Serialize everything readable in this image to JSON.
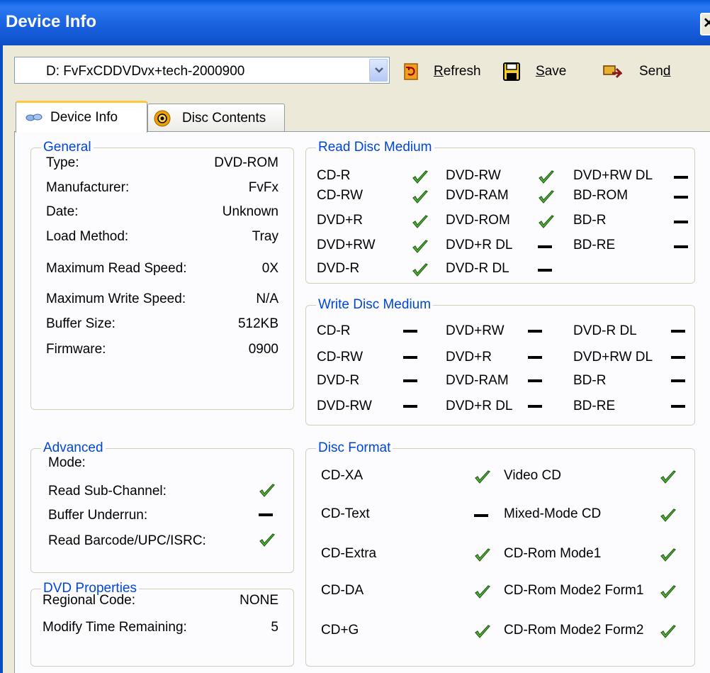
{
  "window": {
    "title": "Device Info"
  },
  "toolbar": {
    "drive_select": "D: FvFxCDDVDvx+tech-2000900",
    "refresh": {
      "pre": "",
      "key": "R",
      "post": "efresh"
    },
    "save": {
      "pre": "",
      "key": "S",
      "post": "ave"
    },
    "send": {
      "pre": "Sen",
      "key": "d",
      "post": ""
    }
  },
  "tabs": {
    "device_info": "Device Info",
    "disc_contents": "Disc Contents"
  },
  "general": {
    "title": "General",
    "rows": [
      {
        "label": "Type:",
        "value": "DVD-ROM"
      },
      {
        "label": "Manufacturer:",
        "value": "FvFx"
      },
      {
        "label": "Date:",
        "value": "Unknown"
      },
      {
        "label": "Load Method:",
        "value": "Tray"
      },
      {
        "label": "Maximum Read Speed:",
        "value": "0X"
      },
      {
        "label": "Maximum Write Speed:",
        "value": "N/A"
      },
      {
        "label": "Buffer Size:",
        "value": "512KB"
      },
      {
        "label": "Firmware:",
        "value": "0900"
      }
    ]
  },
  "advanced": {
    "title": "Advanced",
    "rows": [
      {
        "label": "Mode:",
        "status": ""
      },
      {
        "label": "Read Sub-Channel:",
        "status": "yes"
      },
      {
        "label": "Buffer Underrun:",
        "status": "no"
      },
      {
        "label": "Read Barcode/UPC/ISRC:",
        "status": "yes"
      }
    ]
  },
  "dvd_properties": {
    "title": "DVD Properties",
    "rows": [
      {
        "label": "Regional Code:",
        "value": "NONE"
      },
      {
        "label": "Modify Time Remaining:",
        "value": "5"
      }
    ]
  },
  "read_medium": {
    "title": "Read Disc Medium",
    "columns": [
      [
        {
          "label": "CD-R",
          "status": "yes"
        },
        {
          "label": "CD-RW",
          "status": "yes"
        },
        {
          "label": "DVD+R",
          "status": "yes"
        },
        {
          "label": "DVD+RW",
          "status": "yes"
        },
        {
          "label": "DVD-R",
          "status": "yes"
        }
      ],
      [
        {
          "label": "DVD-RW",
          "status": "yes"
        },
        {
          "label": "DVD-RAM",
          "status": "yes"
        },
        {
          "label": "DVD-ROM",
          "status": "yes"
        },
        {
          "label": "DVD+R DL",
          "status": "no"
        },
        {
          "label": "DVD-R DL",
          "status": "no"
        }
      ],
      [
        {
          "label": "DVD+RW DL",
          "status": "no"
        },
        {
          "label": "BD-ROM",
          "status": "no"
        },
        {
          "label": "BD-R",
          "status": "no"
        },
        {
          "label": "BD-RE",
          "status": "no"
        }
      ]
    ]
  },
  "write_medium": {
    "title": "Write Disc Medium",
    "columns": [
      [
        {
          "label": "CD-R",
          "status": "no"
        },
        {
          "label": "CD-RW",
          "status": "no"
        },
        {
          "label": "DVD-R",
          "status": "no"
        },
        {
          "label": "DVD-RW",
          "status": "no"
        }
      ],
      [
        {
          "label": "DVD+RW",
          "status": "no"
        },
        {
          "label": "DVD+R",
          "status": "no"
        },
        {
          "label": "DVD-RAM",
          "status": "no"
        },
        {
          "label": "DVD+R DL",
          "status": "no"
        }
      ],
      [
        {
          "label": "DVD-R DL",
          "status": "no"
        },
        {
          "label": "DVD+RW DL",
          "status": "no"
        },
        {
          "label": "BD-R",
          "status": "no"
        },
        {
          "label": "BD-RE",
          "status": "no"
        }
      ]
    ]
  },
  "disc_format": {
    "title": "Disc Format",
    "left": [
      {
        "label": "CD-XA",
        "status": "yes"
      },
      {
        "label": "CD-Text",
        "status": "no"
      },
      {
        "label": "CD-Extra",
        "status": "yes"
      },
      {
        "label": "CD-DA",
        "status": "yes"
      },
      {
        "label": "CD+G",
        "status": "yes"
      }
    ],
    "right": [
      {
        "label": "Video CD",
        "status": "yes"
      },
      {
        "label": "Mixed-Mode CD",
        "status": "yes"
      },
      {
        "label": "CD-Rom Mode1",
        "status": "yes"
      },
      {
        "label": "CD-Rom Mode2 Form1",
        "status": "yes"
      },
      {
        "label": "CD-Rom Mode2 Form2",
        "status": "yes"
      }
    ]
  },
  "colors": {
    "title_bar": "#0a5cdc",
    "group_title": "#0046d5",
    "check": "#3aa02c",
    "panel": "#fcfcfe"
  }
}
